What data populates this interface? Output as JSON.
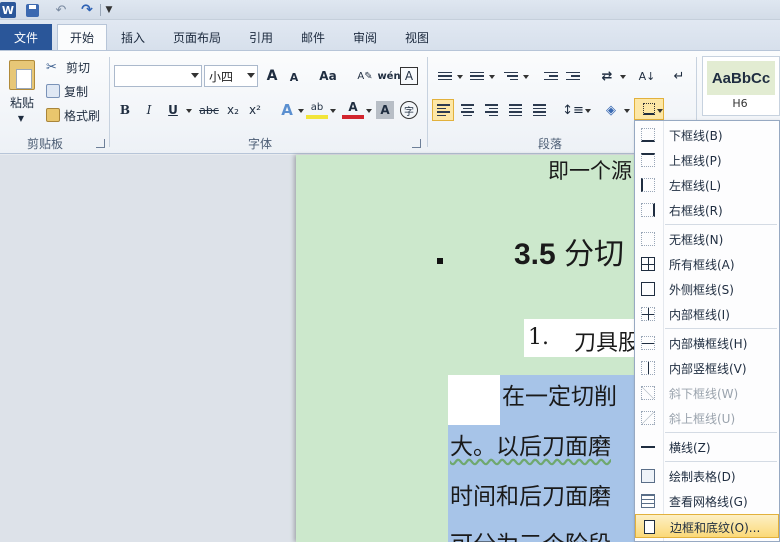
{
  "qat": {
    "logo": "W",
    "undo": "↶",
    "redo": "↷"
  },
  "tabs": [
    {
      "label": "文件"
    },
    {
      "label": "开始"
    },
    {
      "label": "插入"
    },
    {
      "label": "页面布局"
    },
    {
      "label": "引用"
    },
    {
      "label": "邮件"
    },
    {
      "label": "审阅"
    },
    {
      "label": "视图"
    }
  ],
  "ribbon": {
    "clipboard": {
      "paste": "粘贴",
      "cut": "剪切",
      "copy": "复制",
      "format_painter": "格式刷",
      "group": "剪贴板"
    },
    "font": {
      "font_name": "",
      "font_size": "小四",
      "group": "字体",
      "grow": "A",
      "shrink": "A",
      "change_case": "Aa",
      "phonetic": "wén",
      "border_char": "A",
      "bold": "B",
      "italic": "I",
      "underline": "U",
      "strike": "abc",
      "subscript": "x₂",
      "superscript": "x²",
      "effects": "A",
      "highlight": "ab",
      "color": "A",
      "shade": "A",
      "enclose": "字"
    },
    "paragraph": {
      "group": "段落"
    },
    "styles": {
      "sample": "AaBbCc",
      "name": "H6"
    }
  },
  "document": {
    "line1": "即一个源",
    "heading_num": "3.5",
    "heading_text": "分切",
    "list_num": "1.",
    "list_text": "刀具股",
    "para1": "在一定切削",
    "para2": "大。以后刀面磨",
    "para3": "时间和后刀面磨",
    "para4": "可分为三个阶段:"
  },
  "border_menu": {
    "items": [
      {
        "label": "下框线(B)",
        "enabled": true
      },
      {
        "label": "上框线(P)",
        "enabled": true
      },
      {
        "label": "左框线(L)",
        "enabled": true
      },
      {
        "label": "右框线(R)",
        "enabled": true
      },
      {
        "label": "无框线(N)",
        "enabled": true
      },
      {
        "label": "所有框线(A)",
        "enabled": true
      },
      {
        "label": "外侧框线(S)",
        "enabled": true
      },
      {
        "label": "内部框线(I)",
        "enabled": true
      },
      {
        "label": "内部横框线(H)",
        "enabled": true
      },
      {
        "label": "内部竖框线(V)",
        "enabled": true
      },
      {
        "label": "斜下框线(W)",
        "enabled": false
      },
      {
        "label": "斜上框线(U)",
        "enabled": false
      },
      {
        "label": "横线(Z)",
        "enabled": true
      },
      {
        "label": "绘制表格(D)",
        "enabled": true
      },
      {
        "label": "查看网格线(G)",
        "enabled": true
      },
      {
        "label": "边框和底纹(O)...",
        "enabled": true,
        "highlighted": true
      }
    ]
  }
}
